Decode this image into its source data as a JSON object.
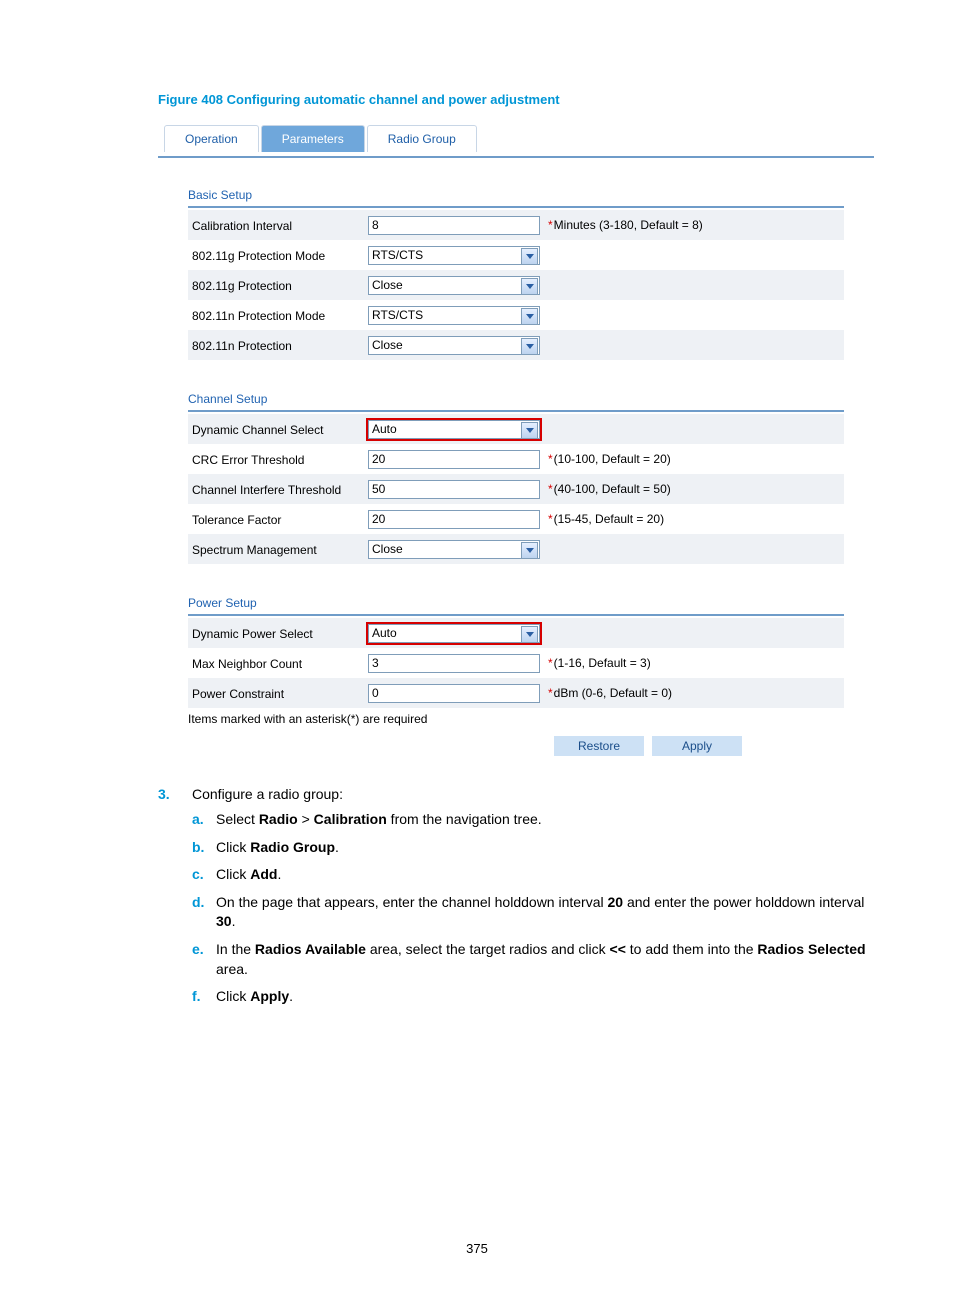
{
  "figureTitle": "Figure 408 Configuring automatic channel and power adjustment",
  "tabs": {
    "t0": "Operation",
    "t1": "Parameters",
    "t2": "Radio Group"
  },
  "sections": {
    "basic": {
      "title": "Basic Setup",
      "rows": {
        "r0": {
          "label": "Calibration Interval",
          "value": "8",
          "hint": "Minutes (3-180, Default = 8)"
        },
        "r1": {
          "label": "802.11g Protection Mode",
          "value": "RTS/CTS"
        },
        "r2": {
          "label": "802.11g Protection",
          "value": "Close"
        },
        "r3": {
          "label": "802.11n Protection Mode",
          "value": "RTS/CTS"
        },
        "r4": {
          "label": "802.11n Protection",
          "value": "Close"
        }
      }
    },
    "channel": {
      "title": "Channel Setup",
      "rows": {
        "r0": {
          "label": "Dynamic Channel Select",
          "value": "Auto"
        },
        "r1": {
          "label": "CRC Error Threshold",
          "value": "20",
          "hint": "(10-100, Default = 20)"
        },
        "r2": {
          "label": "Channel Interfere Threshold",
          "value": "50",
          "hint": "(40-100, Default = 50)"
        },
        "r3": {
          "label": "Tolerance Factor",
          "value": "20",
          "hint": "(15-45, Default = 20)"
        },
        "r4": {
          "label": "Spectrum Management",
          "value": "Close"
        }
      }
    },
    "power": {
      "title": "Power Setup",
      "rows": {
        "r0": {
          "label": "Dynamic Power Select",
          "value": "Auto"
        },
        "r1": {
          "label": "Max Neighbor Count",
          "value": "3",
          "hint": "(1-16, Default = 3)"
        },
        "r2": {
          "label": "Power Constraint",
          "value": "0",
          "hint": "dBm (0-6, Default = 0)"
        }
      }
    }
  },
  "footerNote": "Items marked with an asterisk(*) are required",
  "buttons": {
    "restore": "Restore",
    "apply": "Apply"
  },
  "step": {
    "num": "3.",
    "text": "Configure a radio group:",
    "items": {
      "a": {
        "letter": "a.",
        "pre": "Select ",
        "b1": "Radio",
        "mid": " > ",
        "b2": "Calibration",
        "post": " from the navigation tree."
      },
      "b": {
        "letter": "b.",
        "pre": "Click ",
        "b1": "Radio Group",
        "post": "."
      },
      "c": {
        "letter": "c.",
        "pre": "Click ",
        "b1": "Add",
        "post": "."
      },
      "d": {
        "letter": "d.",
        "pre": "On the page that appears, enter the channel holddown interval ",
        "b1": "20",
        "mid": " and enter the power holddown interval ",
        "b2": "30",
        "post": "."
      },
      "e": {
        "letter": "e.",
        "pre": "In the ",
        "b1": "Radios Available",
        "mid": " area, select the target radios and click ",
        "b2": "<<",
        "mid2": " to add them into the ",
        "b3": "Radios Selected",
        "post": " area."
      },
      "f": {
        "letter": "f.",
        "pre": "Click ",
        "b1": "Apply",
        "post": "."
      }
    }
  },
  "pageNumber": "375"
}
